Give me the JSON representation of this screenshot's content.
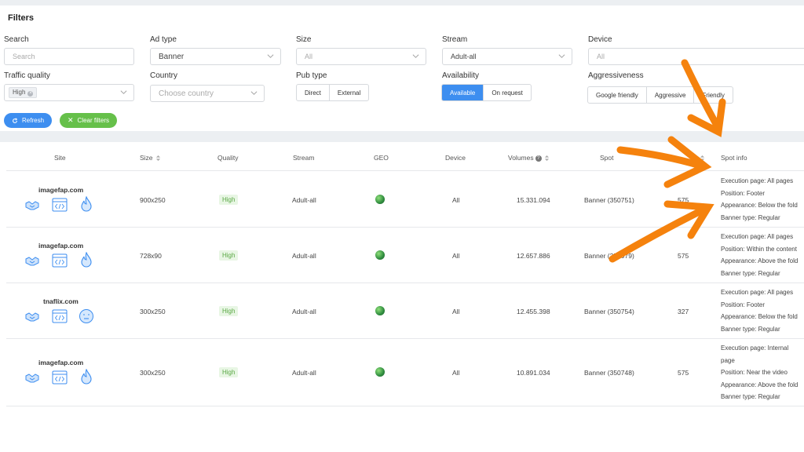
{
  "filters": {
    "title": "Filters",
    "search": {
      "label": "Search",
      "placeholder": "Search"
    },
    "ad_type": {
      "label": "Ad type",
      "value": "Banner"
    },
    "size": {
      "label": "Size",
      "value": "All"
    },
    "stream": {
      "label": "Stream",
      "value": "Adult-all"
    },
    "device": {
      "label": "Device",
      "value": "All"
    },
    "traffic_quality": {
      "label": "Traffic quality",
      "tag": "High"
    },
    "country": {
      "label": "Country",
      "placeholder": "Choose country"
    },
    "pub_type": {
      "label": "Pub type",
      "options": [
        "Direct",
        "External"
      ]
    },
    "availability": {
      "label": "Availability",
      "options": [
        "Available",
        "On request"
      ],
      "active": "Available"
    },
    "aggressiveness": {
      "label": "Aggressiveness",
      "options": [
        "Google friendly",
        "Aggressive",
        "Friendly"
      ]
    },
    "refresh_label": "Refresh",
    "clear_label": "Clear filters"
  },
  "table": {
    "headers": {
      "site": "Site",
      "size": "Size",
      "quality": "Quality",
      "stream": "Stream",
      "geo": "GEO",
      "device": "Device",
      "volumes": "Volumes",
      "spot": "Spot",
      "spot_info": "Spot info"
    },
    "rows": [
      {
        "site": "imagefap.com",
        "status_icon": "fire-icon",
        "size": "900x250",
        "quality": "High",
        "stream": "Adult-all",
        "device": "All",
        "volumes": "15.331.094",
        "spot": "Banner (350751)",
        "price": "575",
        "info": [
          "Execution page: All pages",
          "Position: Footer",
          "Appearance: Below the fold",
          "Banner type: Regular"
        ]
      },
      {
        "site": "imagefap.com",
        "status_icon": "fire-icon",
        "size": "728x90",
        "quality": "High",
        "stream": "Adult-all",
        "device": "All",
        "volumes": "12.657.886",
        "spot": "Banner (359079)",
        "price": "575",
        "info": [
          "Execution page: All pages",
          "Position: Within the content",
          "Appearance: Above the fold",
          "Banner type: Regular"
        ]
      },
      {
        "site": "tnaflix.com",
        "status_icon": "neutral-face-icon",
        "size": "300x250",
        "quality": "High",
        "stream": "Adult-all",
        "device": "All",
        "volumes": "12.455.398",
        "spot": "Banner (350754)",
        "price": "327",
        "info": [
          "Execution page: All pages",
          "Position: Footer",
          "Appearance: Below the fold",
          "Banner type: Regular"
        ]
      },
      {
        "site": "imagefap.com",
        "status_icon": "fire-icon",
        "size": "300x250",
        "quality": "High",
        "stream": "Adult-all",
        "device": "All",
        "volumes": "10.891.034",
        "spot": "Banner (350748)",
        "price": "575",
        "info": [
          "Execution page: Internal",
          "page",
          "Position: Near the video",
          "Appearance: Above the fold",
          "Banner type: Regular"
        ]
      }
    ]
  },
  "colors": {
    "accent": "#3d8ef0",
    "success": "#66c04a",
    "arrow": "#f5820d"
  }
}
